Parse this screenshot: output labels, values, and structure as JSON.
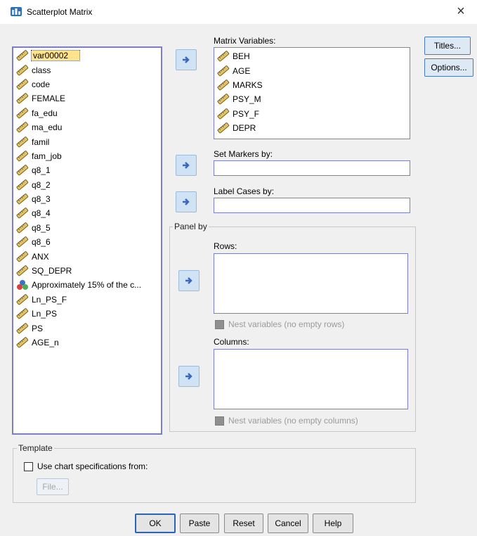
{
  "window": {
    "title": "Scatterplot Matrix",
    "close_glyph": "×"
  },
  "source_vars": [
    {
      "label": "var00002",
      "icon": "scale-ruler-icon",
      "selected": true
    },
    {
      "label": "class",
      "icon": "scale-ruler-icon"
    },
    {
      "label": "code",
      "icon": "scale-ruler-icon"
    },
    {
      "label": "FEMALE",
      "icon": "scale-ruler-icon"
    },
    {
      "label": "fa_edu",
      "icon": "scale-ruler-icon"
    },
    {
      "label": "ma_edu",
      "icon": "scale-ruler-icon"
    },
    {
      "label": "famil",
      "icon": "scale-ruler-icon"
    },
    {
      "label": "fam_job",
      "icon": "scale-ruler-icon"
    },
    {
      "label": "q8_1",
      "icon": "scale-ruler-icon"
    },
    {
      "label": "q8_2",
      "icon": "scale-ruler-icon"
    },
    {
      "label": "q8_3",
      "icon": "scale-ruler-icon"
    },
    {
      "label": "q8_4",
      "icon": "scale-ruler-icon"
    },
    {
      "label": "q8_5",
      "icon": "scale-ruler-icon"
    },
    {
      "label": "q8_6",
      "icon": "scale-ruler-icon"
    },
    {
      "label": "ANX",
      "icon": "scale-ruler-icon"
    },
    {
      "label": "SQ_DEPR",
      "icon": "scale-ruler-icon"
    },
    {
      "label": "Approximately 15% of the c...",
      "icon": "nominal-circles-icon"
    },
    {
      "label": "Ln_PS_F",
      "icon": "scale-ruler-icon"
    },
    {
      "label": "Ln_PS",
      "icon": "scale-ruler-icon"
    },
    {
      "label": "PS",
      "icon": "scale-ruler-icon"
    },
    {
      "label": "AGE_n",
      "icon": "scale-ruler-icon"
    }
  ],
  "matrix": {
    "label": "Matrix Variables:",
    "items": [
      "BEH",
      "AGE",
      "MARKS",
      "PSY_M",
      "PSY_F",
      "DEPR"
    ]
  },
  "markers": {
    "label": "Set Markers by:",
    "value": ""
  },
  "label_cases": {
    "label": "Label Cases by:",
    "value": ""
  },
  "panel": {
    "legend": "Panel by",
    "rows_label": "Rows:",
    "rows_nest": "Nest variables (no empty rows)",
    "columns_label": "Columns:",
    "columns_nest": "Nest variables (no empty columns)"
  },
  "template": {
    "legend": "Template",
    "use_spec": "Use chart specifications from:",
    "file_button": "File..."
  },
  "side_buttons": {
    "titles": "Titles...",
    "options": "Options..."
  },
  "bottom_buttons": {
    "ok": "OK",
    "paste": "Paste",
    "reset": "Reset",
    "cancel": "Cancel",
    "help": "Help"
  },
  "colors": {
    "list_border": "#7b7fc9",
    "selection": "#ffe48c",
    "arrow_button": "#cfe3f5",
    "client_bg": "#f0f0f0"
  }
}
